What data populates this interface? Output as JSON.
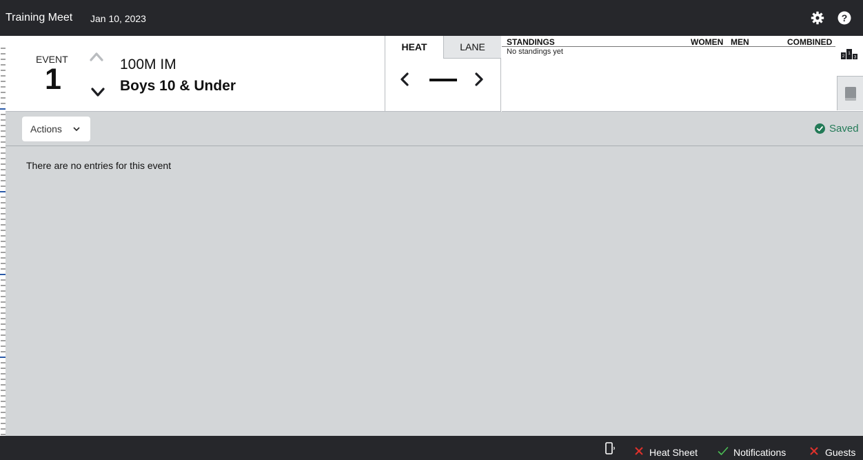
{
  "header": {
    "meet_name": "Training Meet",
    "meet_date": "Jan 10, 2023",
    "icons": [
      "gear-icon",
      "help-icon"
    ]
  },
  "event": {
    "label": "EVENT",
    "number": "1",
    "distance_stroke": "100M IM",
    "group": "Boys 10 & Under"
  },
  "heat_lane": {
    "tabs": [
      "HEAT",
      "LANE"
    ],
    "selected_tab": "HEAT",
    "current_value": "—"
  },
  "standings": {
    "title": "STANDINGS",
    "columns": [
      "WOMEN",
      "MEN",
      "COMBINED"
    ],
    "empty_message": "No standings yet"
  },
  "toolbar": {
    "actions_label": "Actions",
    "saved_label": "Saved"
  },
  "content": {
    "empty_message": "There are no entries for this event"
  },
  "status_bar": {
    "items": [
      {
        "label": "Heat Sheet",
        "state": "error"
      },
      {
        "label": "Notifications",
        "state": "ok"
      },
      {
        "label": "Guests",
        "state": "error"
      }
    ]
  },
  "colors": {
    "topbar": "#26272b",
    "content_bg": "#d3d6d8",
    "saved_green": "#237a57",
    "error_red": "#e0312b",
    "ok_green": "#4bbf55",
    "ruler_blue": "#2a5aa8"
  }
}
